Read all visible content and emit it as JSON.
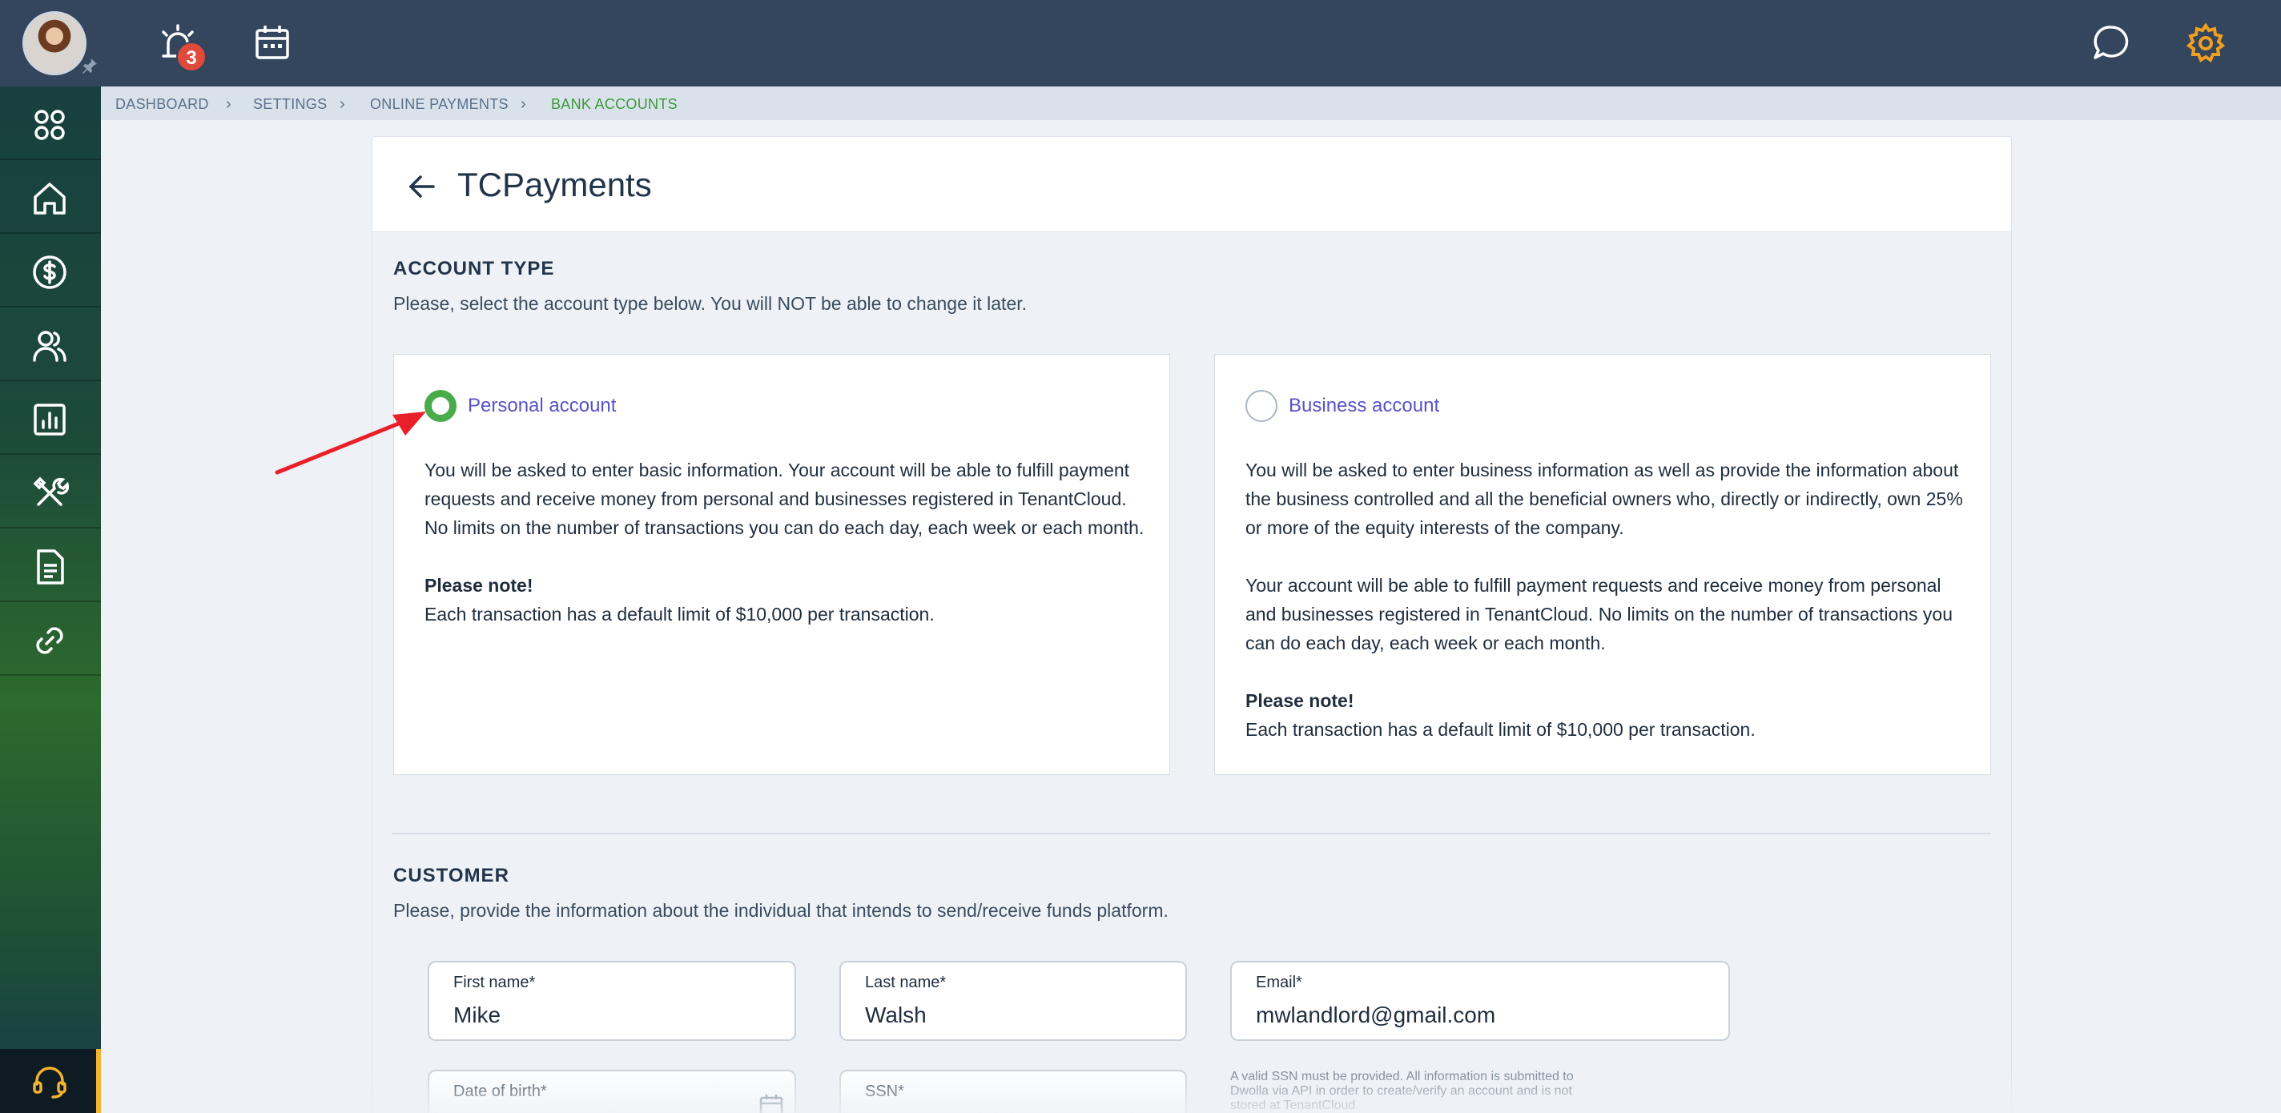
{
  "header": {
    "notifications_count": "3"
  },
  "breadcrumb": [
    "DASHBOARD",
    "SETTINGS",
    "ONLINE PAYMENTS",
    "BANK ACCOUNTS"
  ],
  "page": {
    "title": "TCPayments"
  },
  "account_type": {
    "title": "ACCOUNT TYPE",
    "description": "Please, select the account type below. You will NOT be able to change it later.",
    "selected": "personal",
    "options": [
      {
        "label": "Personal account",
        "paragraphs": [
          "You will be asked to enter basic information. Your account will be able to fulfill payment requests and receive money from personal and businesses registered in TenantCloud. No limits on the number of transactions you can do each day, each week or each month."
        ],
        "note_title": "Please note!",
        "note_text": "Each transaction has a default limit of $10,000 per transaction."
      },
      {
        "label": "Business account",
        "paragraphs": [
          "You will be asked to enter business information as well as provide the information about the business controlled and all the beneficial owners who, directly or indirectly, own 25% or more of the equity interests of the company.",
          "Your account will be able to fulfill payment requests and receive money from personal and businesses registered in TenantCloud. No limits on the number of transactions you can do each day, each week or each month."
        ],
        "note_title": "Please note!",
        "note_text": "Each transaction has a default limit of $10,000 per transaction."
      }
    ]
  },
  "customer": {
    "title": "CUSTOMER",
    "description": "Please, provide the information about the individual that intends to send/receive funds platform.",
    "fields": {
      "first_name": {
        "label": "First name*",
        "value": "Mike"
      },
      "last_name": {
        "label": "Last name*",
        "value": "Walsh"
      },
      "email": {
        "label": "Email*",
        "value": "mwlandlord@gmail.com"
      },
      "dob": {
        "label": "Date of birth*",
        "value": ""
      },
      "ssn": {
        "label": "SSN*",
        "value": ""
      }
    },
    "ssn_note": "A valid SSN must be provided. All information is submitted to Dwolla via API in order to create/verify an account and is not stored at TenantCloud."
  },
  "colors": {
    "topbar": "#33465e",
    "accent_green": "#4aab4a",
    "label_purple": "#5652c8",
    "settings_orange": "#f0a020"
  },
  "icons": {
    "topbar": [
      "avatar",
      "alarm-icon",
      "calendar-icon",
      "chat-icon",
      "settings-gear-icon"
    ],
    "sidebar": [
      "apps-grid-icon",
      "home-icon",
      "dollar-icon",
      "people-icon",
      "reports-chart-icon",
      "tools-icon",
      "document-icon",
      "link-icon",
      "headset-support-icon"
    ]
  }
}
